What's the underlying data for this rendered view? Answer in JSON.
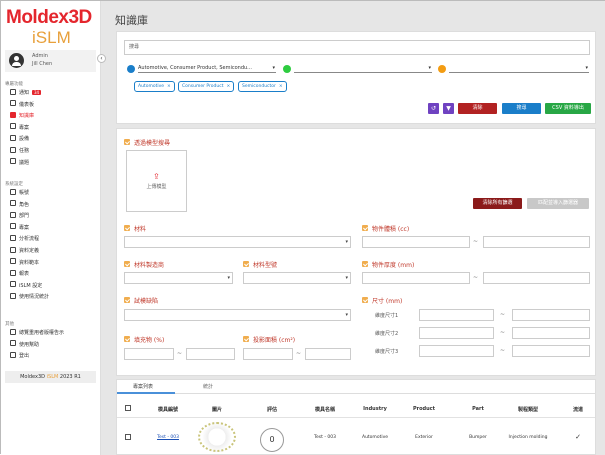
{
  "app": {
    "logo_primary": "Moldex3D",
    "logo_secondary": "iSLM",
    "version_prefix": "Moldex3D",
    "version_product": "iSLM",
    "version_suffix": "2023 R1"
  },
  "user": {
    "role": "Admin",
    "name": "Jill Chen"
  },
  "sidebar": {
    "section1": "專屬功能",
    "section2": "系統設定",
    "section3": "其他",
    "items1": [
      {
        "label": "通知",
        "badge": "34",
        "icon": "bell-icon"
      },
      {
        "label": "儀表板",
        "icon": "dashboard-icon"
      },
      {
        "label": "知識庫",
        "icon": "book-icon",
        "active": true
      },
      {
        "label": "專案",
        "icon": "folder-icon"
      },
      {
        "label": "設備",
        "icon": "machine-icon"
      },
      {
        "label": "任務",
        "icon": "task-icon"
      },
      {
        "label": "議題",
        "icon": "issue-icon"
      }
    ],
    "items2": [
      {
        "label": "帳號",
        "icon": "user-icon"
      },
      {
        "label": "角色",
        "icon": "role-icon"
      },
      {
        "label": "部門",
        "icon": "department-icon"
      },
      {
        "label": "專案",
        "icon": "project-icon"
      },
      {
        "label": "分析流程",
        "icon": "flow-icon"
      },
      {
        "label": "資料定義",
        "icon": "data-icon"
      },
      {
        "label": "資料範本",
        "icon": "template-icon"
      },
      {
        "label": "報表",
        "icon": "report-icon"
      },
      {
        "label": "iSLM 設定",
        "icon": "settings-icon"
      },
      {
        "label": "使用情況統計",
        "icon": "stats-icon"
      }
    ],
    "items3": [
      {
        "label": "總覽重用者版權告示",
        "icon": "license-icon"
      },
      {
        "label": "使用幫助",
        "icon": "help-icon"
      },
      {
        "label": "登出",
        "icon": "logout-icon"
      }
    ]
  },
  "page": {
    "title": "知識庫"
  },
  "search": {
    "placeholder": "搜尋",
    "filter1": "Automotive, Consumer Product, Semicondu...",
    "filter2": "",
    "filter3": "",
    "chips": [
      "Automotive",
      "Consumer Product",
      "Semiconductor"
    ],
    "btn_clear": "清除",
    "btn_search": "搜尋",
    "btn_export": "CSV 資料導出",
    "colors": {
      "blue": "#1a7ec9",
      "green": "#2ecc40",
      "orange": "#f39c12",
      "red": "#b22222",
      "purple": "#6f42c1",
      "teal": "#28a745"
    }
  },
  "form": {
    "model_search": "透過模型搜尋",
    "upload_label": "上傳模型",
    "btn_clear_filters": "清除所有篩選",
    "btn_import": "匹配並導入篩選器",
    "material": "材料",
    "part_volume": "物件體積 (cc)",
    "material_maker": "材料製造商",
    "material_grade": "材料型號",
    "part_thickness": "物件厚度 (mm)",
    "trial_defect": "試模缺陷",
    "size": "尺寸 (mm)",
    "size1": "維度尺寸1",
    "size2": "維度尺寸2",
    "size3": "維度尺寸3",
    "filler": "填充物 (%)",
    "projected_area": "投影面積 (cm²)",
    "dash": "~"
  },
  "table": {
    "tabs": [
      "專案列表",
      "統計"
    ],
    "headers": [
      "模具編號",
      "圖片",
      "評估",
      "模具名稱",
      "Industry",
      "Product",
      "Part",
      "製程類型",
      "流道"
    ],
    "rows": [
      {
        "mold_id": "Test - 003",
        "rating": "0",
        "mold_name": "Test - 003",
        "industry": "Automotive",
        "product": "Exterior",
        "part": "Bumper",
        "process": "Injection molding",
        "runner": "✓"
      }
    ]
  }
}
